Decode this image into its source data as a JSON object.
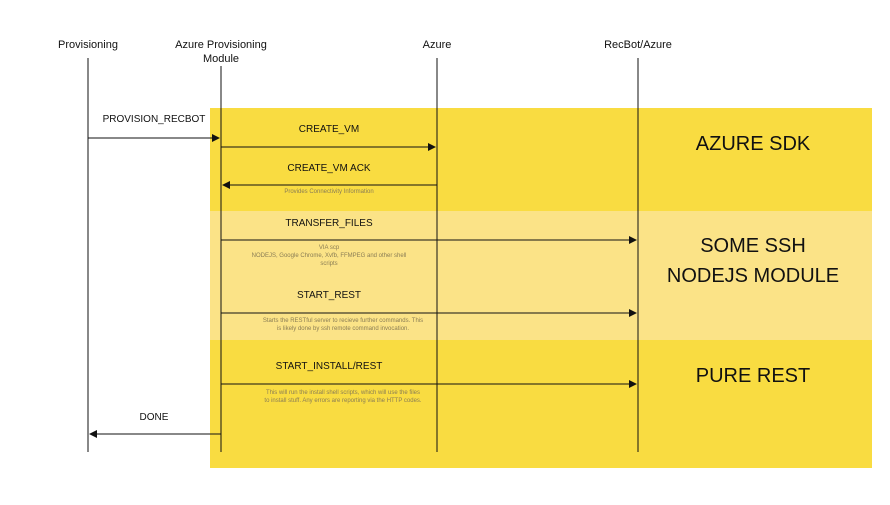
{
  "participants": [
    "Provisioning",
    "Azure Provisioning Module",
    "Azure",
    "RecBot/Azure"
  ],
  "sections": {
    "azure_sdk": "AZURE SDK",
    "ssh_line1": "SOME SSH",
    "ssh_line2": "NODEJS MODULE",
    "pure_rest": "PURE REST"
  },
  "messages": {
    "provision_recbot": "PROVISION_RECBOT",
    "create_vm": "CREATE_VM",
    "create_vm_ack": "CREATE_VM ACK",
    "transfer_files": "TRANSFER_FILES",
    "start_rest": "START_REST",
    "start_install_rest": "START_INSTALL/REST",
    "done": "DONE"
  },
  "notes": {
    "create_vm_ack": "Provides Connectivity Information",
    "transfer_1": "VIA scp",
    "transfer_2": "NODEJS, Google Chrome, Xvfb, FFMPEG and other shell",
    "transfer_3": "scripts",
    "start_rest_1": "Starts the RESTful server to recieve further commands. This",
    "start_rest_2": "is likely done by ssh remote command invocation.",
    "install_1": "This will run the install shell scripts, which will use the files",
    "install_2": "to install stuff. Any errors are reporting via the HTTP codes."
  },
  "colors": {
    "band_dark": "#f9dc41",
    "band_light": "#fbe387",
    "line": "#111111"
  }
}
